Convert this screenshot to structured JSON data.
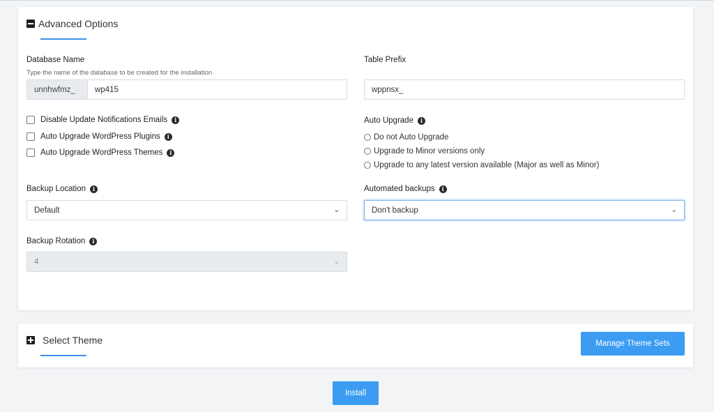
{
  "advanced": {
    "title": "Advanced Options",
    "database_name": {
      "label": "Database Name",
      "hint": "Type the name of the database to be created for the installation",
      "prefix": "unnhwfmz_",
      "value": "wp415"
    },
    "table_prefix": {
      "label": "Table Prefix",
      "value": "wppnsx_"
    },
    "checkboxes": [
      {
        "label": "Disable Update Notifications Emails",
        "checked": false
      },
      {
        "label": "Auto Upgrade WordPress Plugins",
        "checked": false
      },
      {
        "label": "Auto Upgrade WordPress Themes",
        "checked": false
      }
    ],
    "auto_upgrade": {
      "label": "Auto Upgrade",
      "options": [
        "Do not Auto Upgrade",
        "Upgrade to Minor versions only",
        "Upgrade to any latest version available (Major as well as Minor)"
      ]
    },
    "backup_location": {
      "label": "Backup Location",
      "value": "Default"
    },
    "automated_backups": {
      "label": "Automated backups",
      "value": "Don't backup"
    },
    "backup_rotation": {
      "label": "Backup Rotation",
      "value": "4"
    }
  },
  "theme": {
    "title": "Select Theme",
    "manage_label": "Manage Theme Sets"
  },
  "install_label": "Install",
  "icons": {
    "collapse": "minus-square-icon",
    "expand": "plus-square-icon",
    "info": "info-circle-icon",
    "chevron": "chevron-down-icon"
  },
  "colors": {
    "accent": "#3b9cf2",
    "underline": "#3b8ded"
  }
}
